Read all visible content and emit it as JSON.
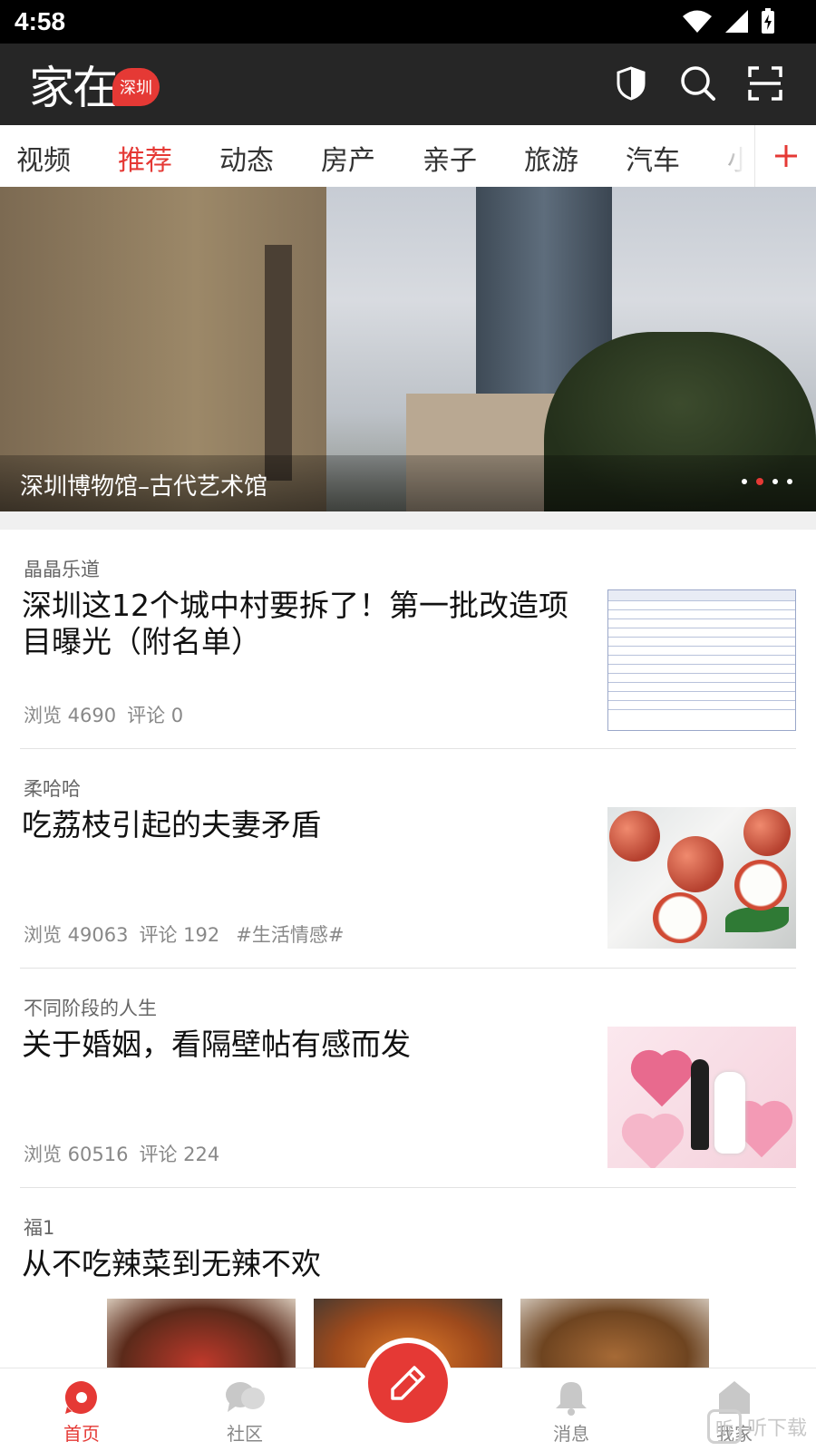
{
  "status_bar": {
    "time": "4:58"
  },
  "header": {
    "logo_text": "家在",
    "city_badge": "深圳"
  },
  "tabs": [
    {
      "label": "视频",
      "active": false
    },
    {
      "label": "推荐",
      "active": true
    },
    {
      "label": "动态",
      "active": false
    },
    {
      "label": "房产",
      "active": false
    },
    {
      "label": "亲子",
      "active": false
    },
    {
      "label": "旅游",
      "active": false
    },
    {
      "label": "汽车",
      "active": false
    },
    {
      "label": "小",
      "active": false
    }
  ],
  "banner": {
    "title": "深圳博物馆–古代艺术馆",
    "dot_count": 4,
    "active_dot": 2
  },
  "feed": [
    {
      "author": "晶晶乐道",
      "title": "深圳这12个城中村要拆了！第一批改造项目曝光（附名单）",
      "views": "浏览 4690",
      "comments": "评论 0",
      "tag": ""
    },
    {
      "author": "柔哈哈",
      "title": "吃荔枝引起的夫妻矛盾",
      "views": "浏览 49063",
      "comments": "评论 192",
      "tag": "#生活情感#"
    },
    {
      "author": "不同阶段的人生",
      "title": "关于婚姻，看隔壁帖有感而发",
      "views": "浏览 60516",
      "comments": "评论 224",
      "tag": ""
    },
    {
      "author": "福1",
      "title": "从不吃辣菜到无辣不欢"
    }
  ],
  "bottom_nav": {
    "home": "首页",
    "community": "社区",
    "messages": "消息",
    "mine": "我家"
  },
  "watermark": {
    "icon_text": "听",
    "text": "听下载"
  },
  "colors": {
    "accent": "#e53935",
    "header_bg": "#262626"
  }
}
